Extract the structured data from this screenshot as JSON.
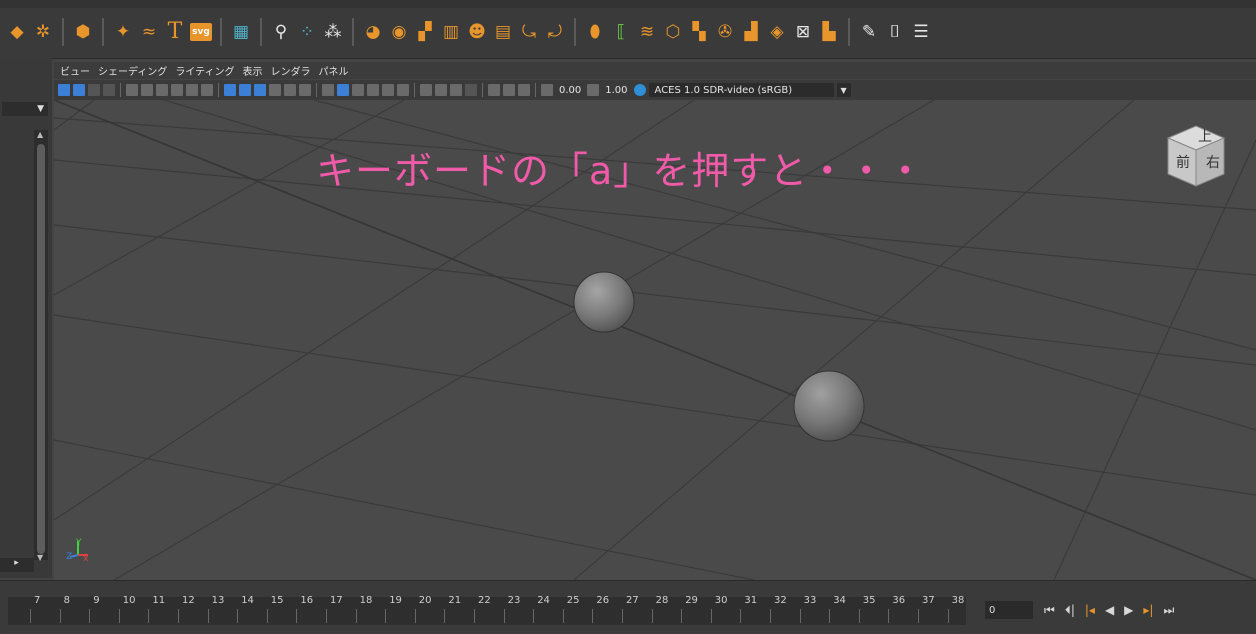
{
  "shelf": {
    "icons": [
      "diamond-icon",
      "pinwheel-icon",
      "polygon-sphere-icon",
      "star-icon",
      "curve-text-icon",
      "type-icon",
      "svg-icon",
      "calculator-icon",
      "joint-icon",
      "dot-grid-icon",
      "scatter-icon",
      "paint-icon",
      "fill-icon",
      "blocks-icon",
      "building-icon",
      "face-icon",
      "grid-icon",
      "bend-icon",
      "flip-icon",
      "cylinder-icon",
      "bracket-select-icon",
      "flow-icon",
      "cube-icon",
      "scatter-cubes-icon",
      "wheel-icon",
      "cube-stack-icon",
      "eye-icon",
      "box-x-icon",
      "wrap-icon",
      "pencil-icon",
      "frame-icon",
      "list-pencil-icon"
    ]
  },
  "panel_menu": {
    "view": "ビュー",
    "shading": "シェーディング",
    "lighting": "ライティング",
    "show": "表示",
    "renderer": "レンダラ",
    "panels": "パネル"
  },
  "panel_toolbar": {
    "exposure": "0.00",
    "gamma": "1.00",
    "color_space": "ACES 1.0 SDR-video (sRGB)"
  },
  "viewport": {
    "overlay_text": "キーボードの「a」を押すと・・・",
    "viewcube_top": "上",
    "viewcube_front": "前",
    "viewcube_right": "右",
    "axis_x": "x",
    "axis_y": "Y",
    "axis_z": "Z"
  },
  "timeline": {
    "ticks": [
      "7",
      "8",
      "9",
      "10",
      "11",
      "12",
      "13",
      "14",
      "15",
      "16",
      "17",
      "18",
      "19",
      "20",
      "21",
      "22",
      "23",
      "24",
      "25",
      "26",
      "27",
      "28",
      "29",
      "30",
      "31",
      "32",
      "33",
      "34",
      "35",
      "36",
      "37",
      "38"
    ],
    "current_frame": "0"
  },
  "playback": {
    "buttons": [
      "go-to-start",
      "step-back-key",
      "step-back-frame",
      "play-backward",
      "play-forward",
      "step-forward-key",
      "go-to-end"
    ]
  }
}
